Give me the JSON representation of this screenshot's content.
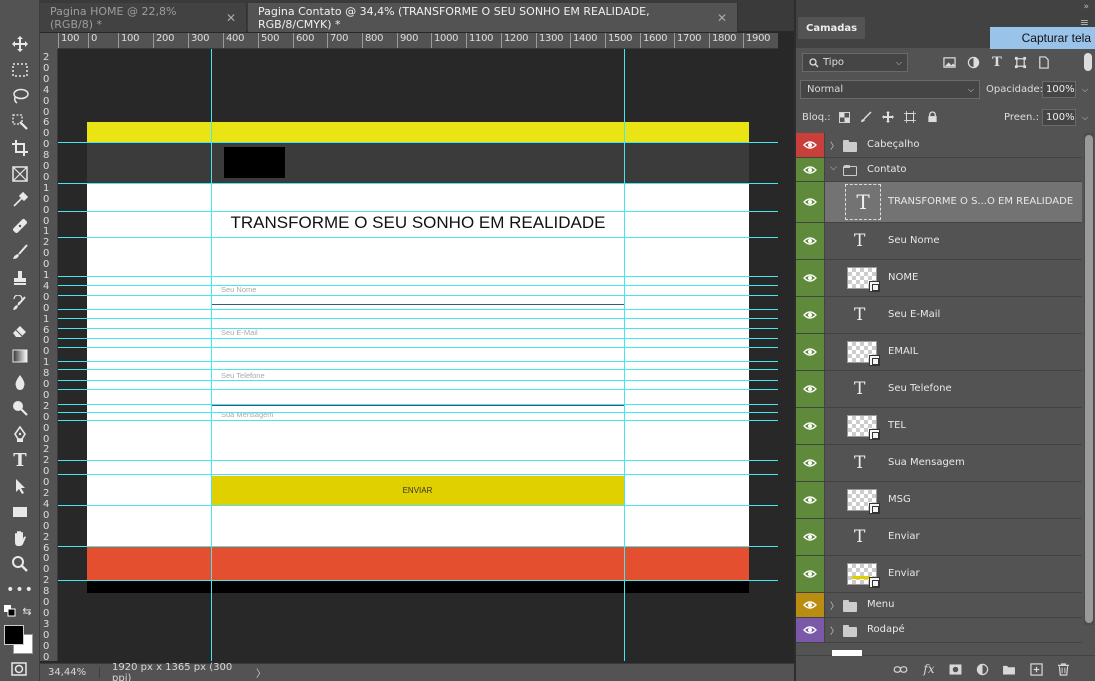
{
  "tabs": [
    {
      "label": "Pagina HOME @ 22,8% (RGB/8) *",
      "active": false
    },
    {
      "label": "Pagina Contato @ 34,4% (TRANSFORME O SEU SONHO EM REALIDADE, RGB/8/CMYK) *",
      "active": true
    }
  ],
  "tab_close": "✕",
  "ruler": {
    "h_ticks": [
      "100",
      "0",
      "100",
      "200",
      "300",
      "400",
      "500",
      "600",
      "700",
      "800",
      "900",
      "1000",
      "1100",
      "1200",
      "1300",
      "1400",
      "1500",
      "1600",
      "1700",
      "1800",
      "1900"
    ],
    "v_ticks": [
      "2",
      "0",
      "0",
      "4",
      "0",
      "0",
      "6",
      "0",
      "0",
      "8",
      "0",
      "0",
      "1",
      "0",
      "0",
      "0",
      "1",
      "2",
      "0",
      "0",
      "1",
      "4",
      "0",
      "0",
      "1",
      "6",
      "0",
      "0",
      "1",
      "8",
      "0",
      "0",
      "2",
      "0",
      "0",
      "0",
      "2",
      "2",
      "0",
      "0",
      "2",
      "4",
      "0",
      "0",
      "2",
      "6",
      "0",
      "0",
      "2",
      "8",
      "0",
      "0",
      "3",
      "0",
      "0",
      "0"
    ]
  },
  "document": {
    "headline": "TRANSFORME O SEU SONHO EM REALIDADE",
    "fields": [
      "Seu Nome",
      "Seu E-Mail",
      "Seu Telefone",
      "Sua Mensagem"
    ],
    "button_label": "ENVIAR",
    "colors": {
      "header_yellow": "#ebe414",
      "header_dark": "#3b3b3b",
      "button": "#e0d000",
      "footer_red": "#e4502f",
      "footer_black": "#000000",
      "guide": "#44e6f0"
    }
  },
  "status": {
    "zoom": "34,44%",
    "doc_info": "1920 px x 1365 px (300 ppi)",
    "arrow": "〉"
  },
  "panel": {
    "title": "Camadas",
    "capture_button": "Capturar tela",
    "filter_kind": "Tipo",
    "blend_mode": "Normal",
    "opacity_label": "Opacidade:",
    "opacity_value": "100%",
    "lock_label": "Bloq.:",
    "fill_label": "Preen.:",
    "fill_value": "100%",
    "layers": [
      {
        "name": "Cabeçalho",
        "kind": "group",
        "collapsed": true,
        "color": "#c9403a"
      },
      {
        "name": "Contato",
        "kind": "group",
        "collapsed": false,
        "color": "#5f8a3b"
      },
      {
        "name": "TRANSFORME O S...O EM REALIDADE",
        "kind": "text",
        "selected": true,
        "color": "#5f8a3b"
      },
      {
        "name": "Seu Nome",
        "kind": "text",
        "color": "#5f8a3b"
      },
      {
        "name": "NOME",
        "kind": "shape",
        "color": "#5f8a3b"
      },
      {
        "name": "Seu E-Mail",
        "kind": "text",
        "color": "#5f8a3b"
      },
      {
        "name": "EMAIL",
        "kind": "shape",
        "color": "#5f8a3b"
      },
      {
        "name": "Seu Telefone",
        "kind": "text",
        "color": "#5f8a3b"
      },
      {
        "name": "TEL",
        "kind": "shape",
        "color": "#5f8a3b"
      },
      {
        "name": "Sua Mensagem",
        "kind": "text",
        "color": "#5f8a3b"
      },
      {
        "name": "MSG",
        "kind": "shape",
        "color": "#5f8a3b"
      },
      {
        "name": "Enviar",
        "kind": "text",
        "color": "#5f8a3b"
      },
      {
        "name": "Enviar",
        "kind": "shape",
        "color": "#5f8a3b"
      },
      {
        "name": "Menu",
        "kind": "group",
        "collapsed": true,
        "color": "#b88d12"
      },
      {
        "name": "Rodapé",
        "kind": "group",
        "collapsed": true,
        "color": "#7a5aa8"
      }
    ]
  }
}
